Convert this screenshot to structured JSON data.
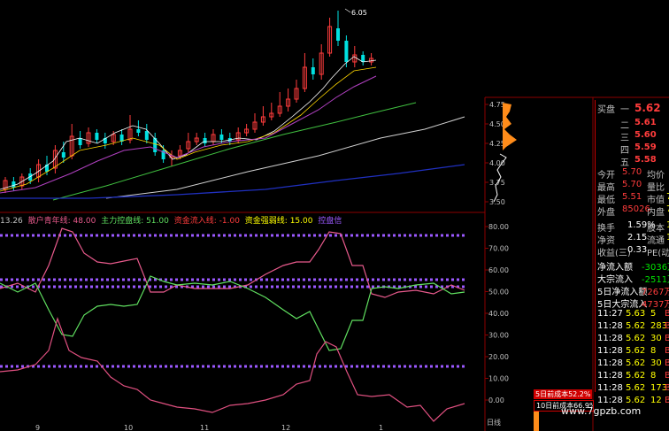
{
  "colors": {
    "red": "#ff3c3c",
    "green": "#00e600",
    "yellow": "#ffff00",
    "white": "#ffffff",
    "label": "#c0c0c0",
    "pink": "#e85a8c",
    "lightgreen": "#60e060",
    "purple": "#9b59ff",
    "orange": "#ff8c1a"
  },
  "main": {
    "peak_label": "6.05",
    "price_axis": [
      "4.75",
      "4.50",
      "4.25",
      "4.00",
      "3.75",
      "3.50"
    ]
  },
  "indicator": {
    "legend": {
      "time": "13.26",
      "sanhu": "散户青年线: 48.00",
      "zhuli": "主力控盘线: 51.00",
      "zijin": "资金流入线: -1.00",
      "qiangruo": "资金强弱线: 15.00",
      "kongpan": "控盘信"
    },
    "axis": [
      "80.00",
      "70.00",
      "60.00",
      "50.00",
      "40.00",
      "30.00",
      "20.00",
      "10.00",
      "0.00"
    ],
    "axis_bottom": "日线"
  },
  "bottom_axis": [
    "9",
    "10",
    "11",
    "12",
    "1"
  ],
  "quote": {
    "buy_label": "买盘",
    "bids": [
      {
        "level": "一",
        "price": "5.62"
      },
      {
        "level": "二",
        "price": "5.61"
      },
      {
        "level": "三",
        "price": "5.60"
      },
      {
        "level": "四",
        "price": "5.59"
      },
      {
        "level": "五",
        "price": "5.58"
      }
    ],
    "stats": [
      {
        "k": "今开",
        "v": "5.70",
        "k2": "均价"
      },
      {
        "k": "最高",
        "v": "5.70",
        "k2": "量比"
      },
      {
        "k": "最低",
        "v": "5.51",
        "k2": "市值",
        "v2": "74"
      },
      {
        "k": "外盘",
        "v": "85026",
        "k2": "内盘",
        "v2": "7"
      }
    ],
    "stats2": [
      {
        "k": "换手",
        "v": "1.59%",
        "k2": "股本",
        "v2": "13"
      },
      {
        "k": "净资",
        "v": "2.15",
        "k2": "流通",
        "v2": "13"
      },
      {
        "k": "收益(三)",
        "v": "0.33",
        "k2": "PE(动)"
      }
    ],
    "flows": [
      {
        "k": "净流入额",
        "v": "-3036万"
      },
      {
        "k": "大宗流入",
        "v": "-2511万"
      },
      {
        "k": "5日净流入额",
        "v": "7267万"
      },
      {
        "k": "5日大宗流入",
        "v": "4737万"
      }
    ],
    "ticks": [
      {
        "t": "11:27",
        "p": "5.63",
        "v": "5"
      },
      {
        "t": "11:28",
        "p": "5.62",
        "v": "283"
      },
      {
        "t": "11:28",
        "p": "5.62",
        "v": "30"
      },
      {
        "t": "11:28",
        "p": "5.62",
        "v": "8"
      },
      {
        "t": "11:28",
        "p": "5.62",
        "v": "30"
      },
      {
        "t": "11:28",
        "p": "5.62",
        "v": "8"
      },
      {
        "t": "11:28",
        "p": "5.62",
        "v": "173"
      },
      {
        "t": "11:28",
        "p": "5.62",
        "v": "12"
      }
    ]
  },
  "cost": {
    "c5": "5日前成本52.2%",
    "c10": "10日前成本66.9%"
  },
  "watermark": "www.7gpzb.com"
}
